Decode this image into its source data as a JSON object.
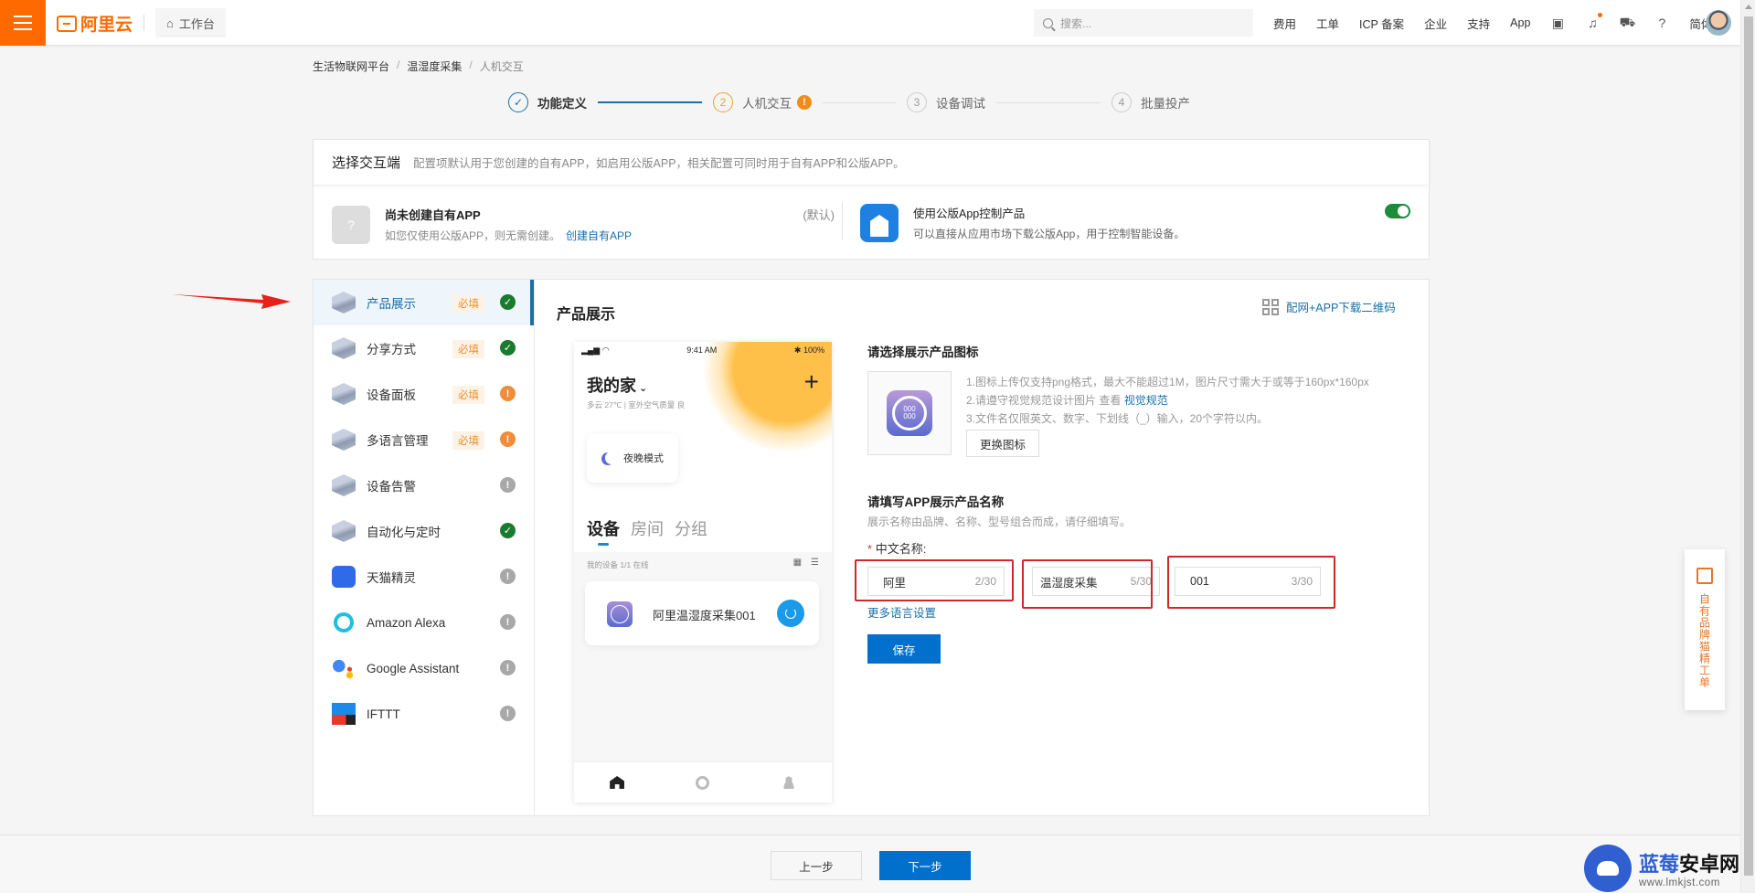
{
  "topbar": {
    "brand": "阿里云",
    "workbench": "工作台",
    "search_placeholder": "搜索...",
    "links": [
      "费用",
      "工单",
      "ICP 备案",
      "企业",
      "支持",
      "App"
    ],
    "language": "简体"
  },
  "breadcrumb": [
    "生活物联网平台",
    "温湿度采集",
    "人机交互"
  ],
  "steps": [
    {
      "num": "✓",
      "label": "功能定义",
      "state": "done"
    },
    {
      "num": "2",
      "label": "人机交互",
      "state": "active",
      "warn": "!"
    },
    {
      "num": "3",
      "label": "设备调试",
      "state": "pending"
    },
    {
      "num": "4",
      "label": "批量投产",
      "state": "pending"
    }
  ],
  "interaction": {
    "title": "选择交互端",
    "desc": "配置项默认用于您创建的自有APP，如启用公版APP，相关配置可同时用于自有APP和公版APP。",
    "own_app": {
      "icon_text": "?",
      "title": "尚未创建自有APP",
      "desc": "如您仅使用公版APP，则无需创建。",
      "link": "创建自有APP",
      "default_tag": "(默认)"
    },
    "public_app": {
      "title": "使用公版App控制产品",
      "desc": "可以直接从应用市场下载公版App，用于控制智能设备。",
      "enabled": true
    }
  },
  "sidebar": {
    "items": [
      {
        "label": "产品展示",
        "required": "必填",
        "status": "ok",
        "active": true
      },
      {
        "label": "分享方式",
        "required": "必填",
        "status": "ok"
      },
      {
        "label": "设备面板",
        "required": "必填",
        "status": "warn"
      },
      {
        "label": "多语言管理",
        "required": "必填",
        "status": "warn"
      },
      {
        "label": "设备告警",
        "status": "gray"
      },
      {
        "label": "自动化与定时",
        "status": "ok"
      },
      {
        "label": "天猫精灵",
        "status": "gray"
      },
      {
        "label": "Amazon Alexa",
        "status": "gray"
      },
      {
        "label": "Google Assistant",
        "status": "gray"
      },
      {
        "label": "IFTTT",
        "status": "gray"
      }
    ]
  },
  "content": {
    "title": "产品展示",
    "qr_link": "配网+APP下载二维码",
    "phone": {
      "time": "9:41 AM",
      "battery": "✱ 100%",
      "home": "我的家",
      "weather": "多云 27℃  |  室外空气质量 良",
      "scene": "夜晚模式",
      "tabs": [
        "设备",
        "房间",
        "分组"
      ],
      "my_devices": "我的设备   1/1 在线",
      "device_name": "阿里温湿度采集001"
    },
    "icon_section": {
      "title": "请选择展示产品图标",
      "rule1": "1.图标上传仅支持png格式，最大不能超过1M，图片尺寸需大于或等于160px*160px",
      "rule2": "2.请遵守视觉规范设计图片 查看 ",
      "rule2_link": "视觉规范",
      "rule3": "3.文件名仅限英文、数字、下划线（_）输入，20个字符以内。",
      "change_button": "更换图标",
      "icon_glyph": "000\n000"
    },
    "name_section": {
      "title": "请填写APP展示产品名称",
      "desc": "展示名称由品牌、名称、型号组合而成，请仔细填写。",
      "required_mark": "*",
      "label": "中文名称:",
      "inputs": [
        {
          "value": "阿里",
          "count": "2/30"
        },
        {
          "value": "温湿度采集",
          "count": "5/30"
        },
        {
          "value": "001",
          "count": "3/30"
        }
      ],
      "more_lang": "更多语言设置",
      "save": "保存"
    }
  },
  "footer": {
    "prev": "上一步",
    "next": "下一步"
  },
  "float_button": "自有品牌猫精工单",
  "watermark": {
    "title_blue": "蓝莓",
    "title_dark": "安卓网",
    "url": "www.lmkjst.com"
  }
}
